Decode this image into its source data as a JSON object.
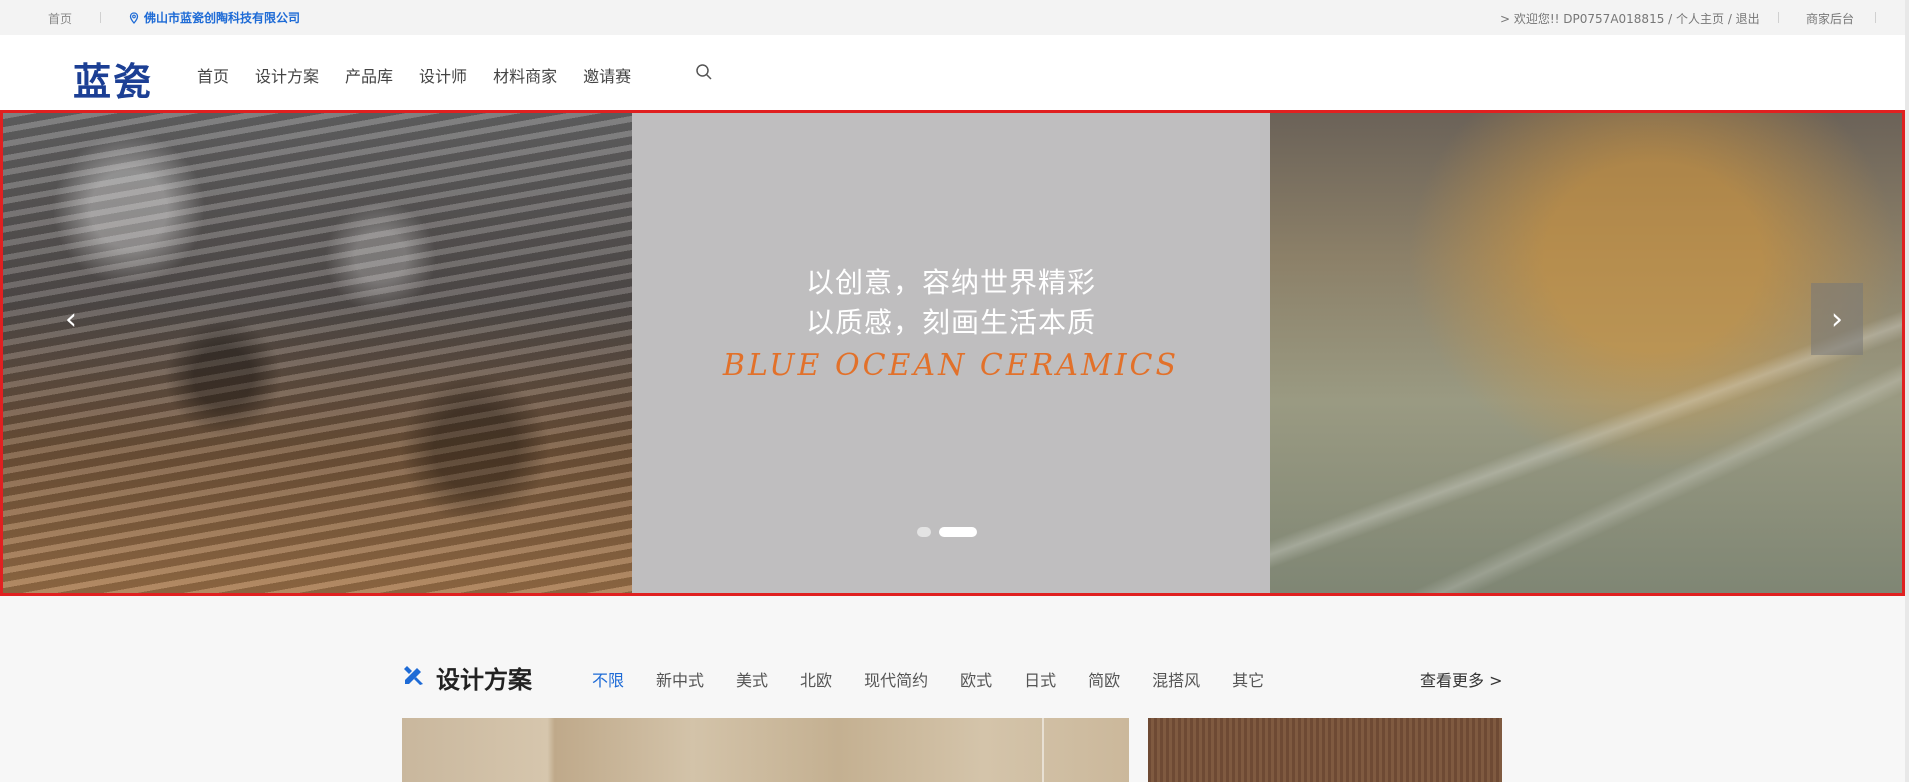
{
  "topbar": {
    "home": "首页",
    "location": "佛山市蓝瓷创陶科技有限公司",
    "welcome": "> 欢迎您!! DP0757A018815 / 个人主页 / 退出",
    "admin": "商家后台"
  },
  "header": {
    "logo": "蓝瓷",
    "nav": [
      "首页",
      "设计方案",
      "产品库",
      "设计师",
      "材料商家",
      "邀请赛"
    ]
  },
  "banner": {
    "slogan_line1": "以创意，容纳世界精彩",
    "slogan_line2": "以质感，刻画生活本质",
    "brand_en": "BLUE OCEAN CERAMICS",
    "active_slide": 2,
    "slide_count": 2,
    "prev_arrow": "‹",
    "next_arrow": "›"
  },
  "section": {
    "title": "设计方案",
    "tabs": [
      "不限",
      "新中式",
      "美式",
      "北欧",
      "现代简约",
      "欧式",
      "日式",
      "简欧",
      "混搭风",
      "其它"
    ],
    "active_tab": "不限",
    "more": "查看更多 >"
  },
  "colors": {
    "accent": "#1e6bd6",
    "logo": "#1c3f94",
    "brand_en": "#e2712a",
    "banner_border": "#e02020"
  },
  "icons": [
    "location-pin-icon",
    "search-icon",
    "design-tools-icon",
    "chevron-left-icon",
    "chevron-right-icon"
  ]
}
